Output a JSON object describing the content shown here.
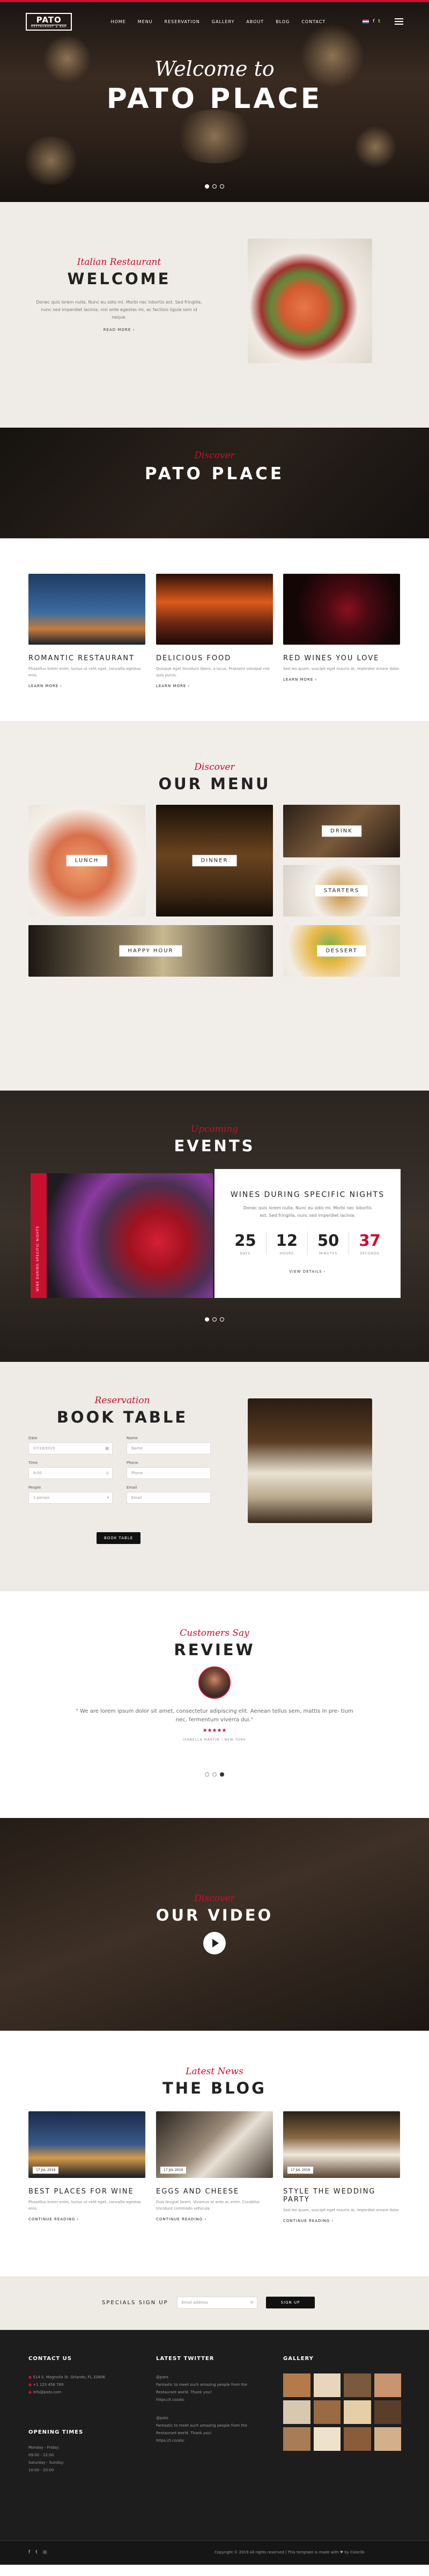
{
  "brand": {
    "name": "PATO",
    "tagline": "RESTAURANT & BAR"
  },
  "nav": {
    "items": [
      "HOME",
      "MENU",
      "RESERVATION",
      "GALLERY",
      "ABOUT",
      "BLOG",
      "CONTACT"
    ]
  },
  "hero": {
    "subtitle": "Welcome to",
    "title": "PATO PLACE"
  },
  "welcome": {
    "kicker": "Italian Restaurant",
    "title": "WELCOME",
    "text": "Donec quis lorem nulla. Nunc eu odio mi. Morbi nec lobortis est. Sed fringilla, nunc sed imperdiet lacinia, nisl ante egestas mi, ac facilisis ligula sem id neque.",
    "link": "READ MORE"
  },
  "discover": {
    "kicker": "Discover",
    "title": "PATO PLACE"
  },
  "features": [
    {
      "title": "ROMANTIC RESTAURANT",
      "text": "Phasellus lorem enim, luctus ut velit eget, convallis egestas eros.",
      "link": "LEARN MORE"
    },
    {
      "title": "DELICIOUS FOOD",
      "text": "Quisque eget tincidunt libero, a lacus. Praesent volutpat nisl quis purus.",
      "link": "LEARN MORE"
    },
    {
      "title": "RED WINES YOU LOVE",
      "text": "Sed leo quam, suscipit eget mauris at, imperdiet ornare dolor.",
      "link": "LEARN MORE"
    }
  ],
  "menu": {
    "kicker": "Discover",
    "title": "OUR MENU",
    "tiles": [
      "LUNCH",
      "DINNER",
      "DRINK",
      "STARTERS",
      "HAPPY HOUR",
      "DESSERT"
    ]
  },
  "events": {
    "kicker": "Upcoming",
    "title": "EVENTS",
    "side_label": "WINE DURING SPECIFIC NIGHTS",
    "card_title": "WINES DURING SPECIFIC NIGHTS",
    "card_text": "Donec quis lorem nulla. Nunc eu odio mi. Morbi nec lobortis est. Sed fringilla, nunc sed imperdiet lacinia.",
    "countdown": [
      {
        "value": "25",
        "unit": "DAYS"
      },
      {
        "value": "12",
        "unit": "HOURS"
      },
      {
        "value": "50",
        "unit": "MINUTES"
      },
      {
        "value": "37",
        "unit": "SECONDS"
      }
    ],
    "link": "VIEW DETAILS"
  },
  "booking": {
    "kicker": "Reservation",
    "title": "BOOK TABLE",
    "fields": [
      {
        "label": "Date",
        "placeholder": "07/18/2019"
      },
      {
        "label": "Name",
        "placeholder": "Name"
      },
      {
        "label": "Time",
        "placeholder": "9:00"
      },
      {
        "label": "Phone",
        "placeholder": "Phone"
      },
      {
        "label": "People",
        "placeholder": "1 person"
      },
      {
        "label": "Email",
        "placeholder": "Email"
      }
    ],
    "button": "BOOK TABLE"
  },
  "review": {
    "kicker": "Customers Say",
    "title": "REVIEW",
    "quote": "\" We are lorem ipsum dolor sit amet, consectetur adipiscing elit. Aenean tellus sem, mattis in pre- tium nec, fermentum viverra dui.\"",
    "stars": "★★★★★",
    "author": "ISABELLA MARTIN - NEW YORK"
  },
  "video": {
    "kicker": "Discover",
    "title": "OUR VIDEO"
  },
  "blog": {
    "kicker": "Latest News",
    "title": "THE BLOG",
    "posts": [
      {
        "date": "17 JUL 2019",
        "title": "BEST PLACES FOR WINE",
        "text": "Phasellus lorem enim, luctus ut velit eget, convallis egestas eros.",
        "link": "CONTINUE READING"
      },
      {
        "date": "17 JUL 2019",
        "title": "EGGS AND CHEESE",
        "text": "Duis feugiat lorem. Vivamus at ante ac enim. Curabitur tincidunt commodo vehicula.",
        "link": "CONTINUE READING"
      },
      {
        "date": "17 JUL 2019",
        "title": "STYLE THE WEDDING PARTY",
        "text": "Sed leo quam, suscipit eget mauris at, imperdiet ornare dolor.",
        "link": "CONTINUE READING"
      }
    ]
  },
  "signup": {
    "label": "SPECIALS SIGN UP",
    "placeholder": "Email address",
    "button": "SIGN UP"
  },
  "footer": {
    "contact_title": "CONTACT US",
    "contact": [
      "514 S. Magnolia St. Orlando, FL 32806",
      "+1 123 456 789",
      "info@pato.com"
    ],
    "hours_title": "OPENING TIMES",
    "hours": [
      "Monday - Friday:",
      "09:00 - 22:00",
      "Saturday - Sunday:",
      "10:00 - 20:00"
    ],
    "twitter_title": "LATEST TWITTER",
    "tweets": [
      {
        "handle": "@pato",
        "text": "Fantastic to meet such amazing people from the Restaurant world. Thank you!",
        "link": "https://t.co/abc"
      },
      {
        "handle": "@pato",
        "text": "Fantastic to meet such amazing people from the Restaurant world. Thank you!",
        "link": "https://t.co/abc"
      }
    ],
    "gallery_title": "GALLERY",
    "copyright": "Copyright © 2019 All rights reserved | This template is made with ♥ by Colorlib"
  },
  "colors": {
    "accent": "#c8102e",
    "dark": "#1d1d1d",
    "light_bg": "#efece7"
  }
}
